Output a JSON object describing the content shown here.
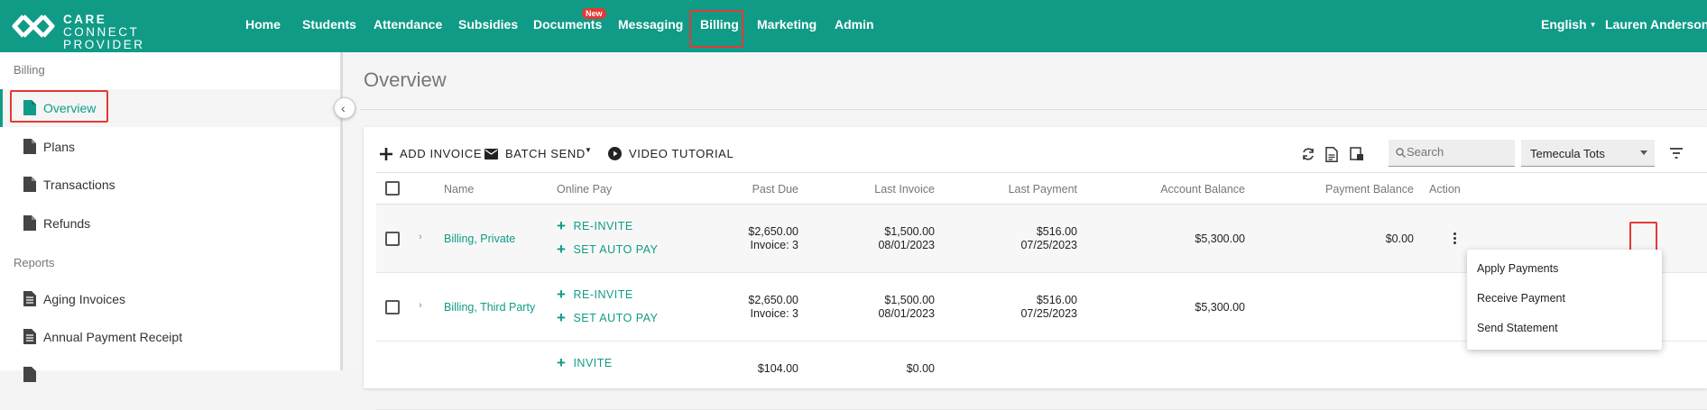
{
  "app": {
    "logo_line1": "CARE",
    "logo_line2": "CONNECT PROVIDER"
  },
  "nav": {
    "items": [
      "Home",
      "Students",
      "Attendance",
      "Subsidies",
      "Documents",
      "Messaging",
      "Billing",
      "Marketing",
      "Admin"
    ],
    "documents_badge": "New",
    "active": "Billing",
    "language": "English",
    "user": "Lauren Anderson"
  },
  "sidebar": {
    "billing_header": "Billing",
    "billing_items": [
      "Overview",
      "Plans",
      "Transactions",
      "Refunds"
    ],
    "reports_header": "Reports",
    "report_items": [
      "Aging Invoices",
      "Annual Payment Receipt"
    ],
    "active_item": "Overview"
  },
  "page": {
    "title": "Overview"
  },
  "toolbar": {
    "add_invoice": "ADD INVOICE",
    "batch_send": "BATCH SEND",
    "video_tutorial": "VIDEO TUTORIAL",
    "search_placeholder": "Search",
    "center_select": "Temecula Tots"
  },
  "table": {
    "columns": [
      "Name",
      "Online Pay",
      "Past Due",
      "Last Invoice",
      "Last Payment",
      "Account Balance",
      "Payment Balance",
      "Action"
    ],
    "rows": [
      {
        "name": "Billing, Private",
        "online_pay": [
          "RE-INVITE",
          "SET AUTO PAY"
        ],
        "past_due": "$2,650.00",
        "past_due_sub": "Invoice: 3",
        "last_invoice": "$1,500.00",
        "last_invoice_date": "08/01/2023",
        "last_payment": "$516.00",
        "last_payment_date": "07/25/2023",
        "account_balance": "$5,300.00",
        "payment_balance": "$0.00"
      },
      {
        "name": "Billing, Third Party",
        "online_pay": [
          "RE-INVITE",
          "SET AUTO PAY"
        ],
        "past_due": "$2,650.00",
        "past_due_sub": "Invoice: 3",
        "last_invoice": "$1,500.00",
        "last_invoice_date": "08/01/2023",
        "last_payment": "$516.00",
        "last_payment_date": "07/25/2023",
        "account_balance": "$5,300.00",
        "payment_balance": ""
      },
      {
        "name": "",
        "online_pay": [
          "INVITE"
        ],
        "past_due": "$104.00",
        "last_invoice": "$0.00"
      }
    ]
  },
  "action_menu": {
    "items": [
      "Apply Payments",
      "Receive Payment",
      "Send Statement"
    ]
  }
}
